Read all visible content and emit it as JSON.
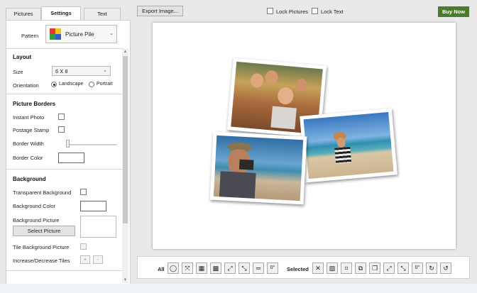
{
  "tabs": [
    "Pictures",
    "Settings",
    "Text"
  ],
  "pattern": {
    "label": "Pattern",
    "value": "Picture Pile"
  },
  "layout": {
    "header": "Layout",
    "size_label": "Size",
    "size_value": "6 X 8",
    "orientation_label": "Orientation",
    "landscape": "Landscape",
    "portrait": "Portrait",
    "selected_orientation": "Landscape"
  },
  "borders": {
    "header": "Picture Borders",
    "instant_photo": "Instant Photo",
    "postage_stamp": "Postage Stamp",
    "border_width": "Border Width",
    "border_color": "Border Color"
  },
  "background": {
    "header": "Background",
    "transparent": "Transparent Background",
    "color": "Background Color",
    "picture": "Background Picture",
    "select_picture": "Select Picture",
    "tile": "Tile Background Picture",
    "tiles": "Increase/Decrease Tiles"
  },
  "toolbar": {
    "export": "Export Image...",
    "lock_pictures": "Lock Pictures",
    "lock_text": "Lock Text",
    "buy_now": "Buy Now"
  },
  "bottom_toolbar": {
    "all_label": "All",
    "selected_label": "Selected",
    "rotate_zero": "0°"
  },
  "colors": {
    "buy_now": "#4c7a2e",
    "panel_bg": "#ffffff",
    "window_bg": "#e9e9e9"
  }
}
